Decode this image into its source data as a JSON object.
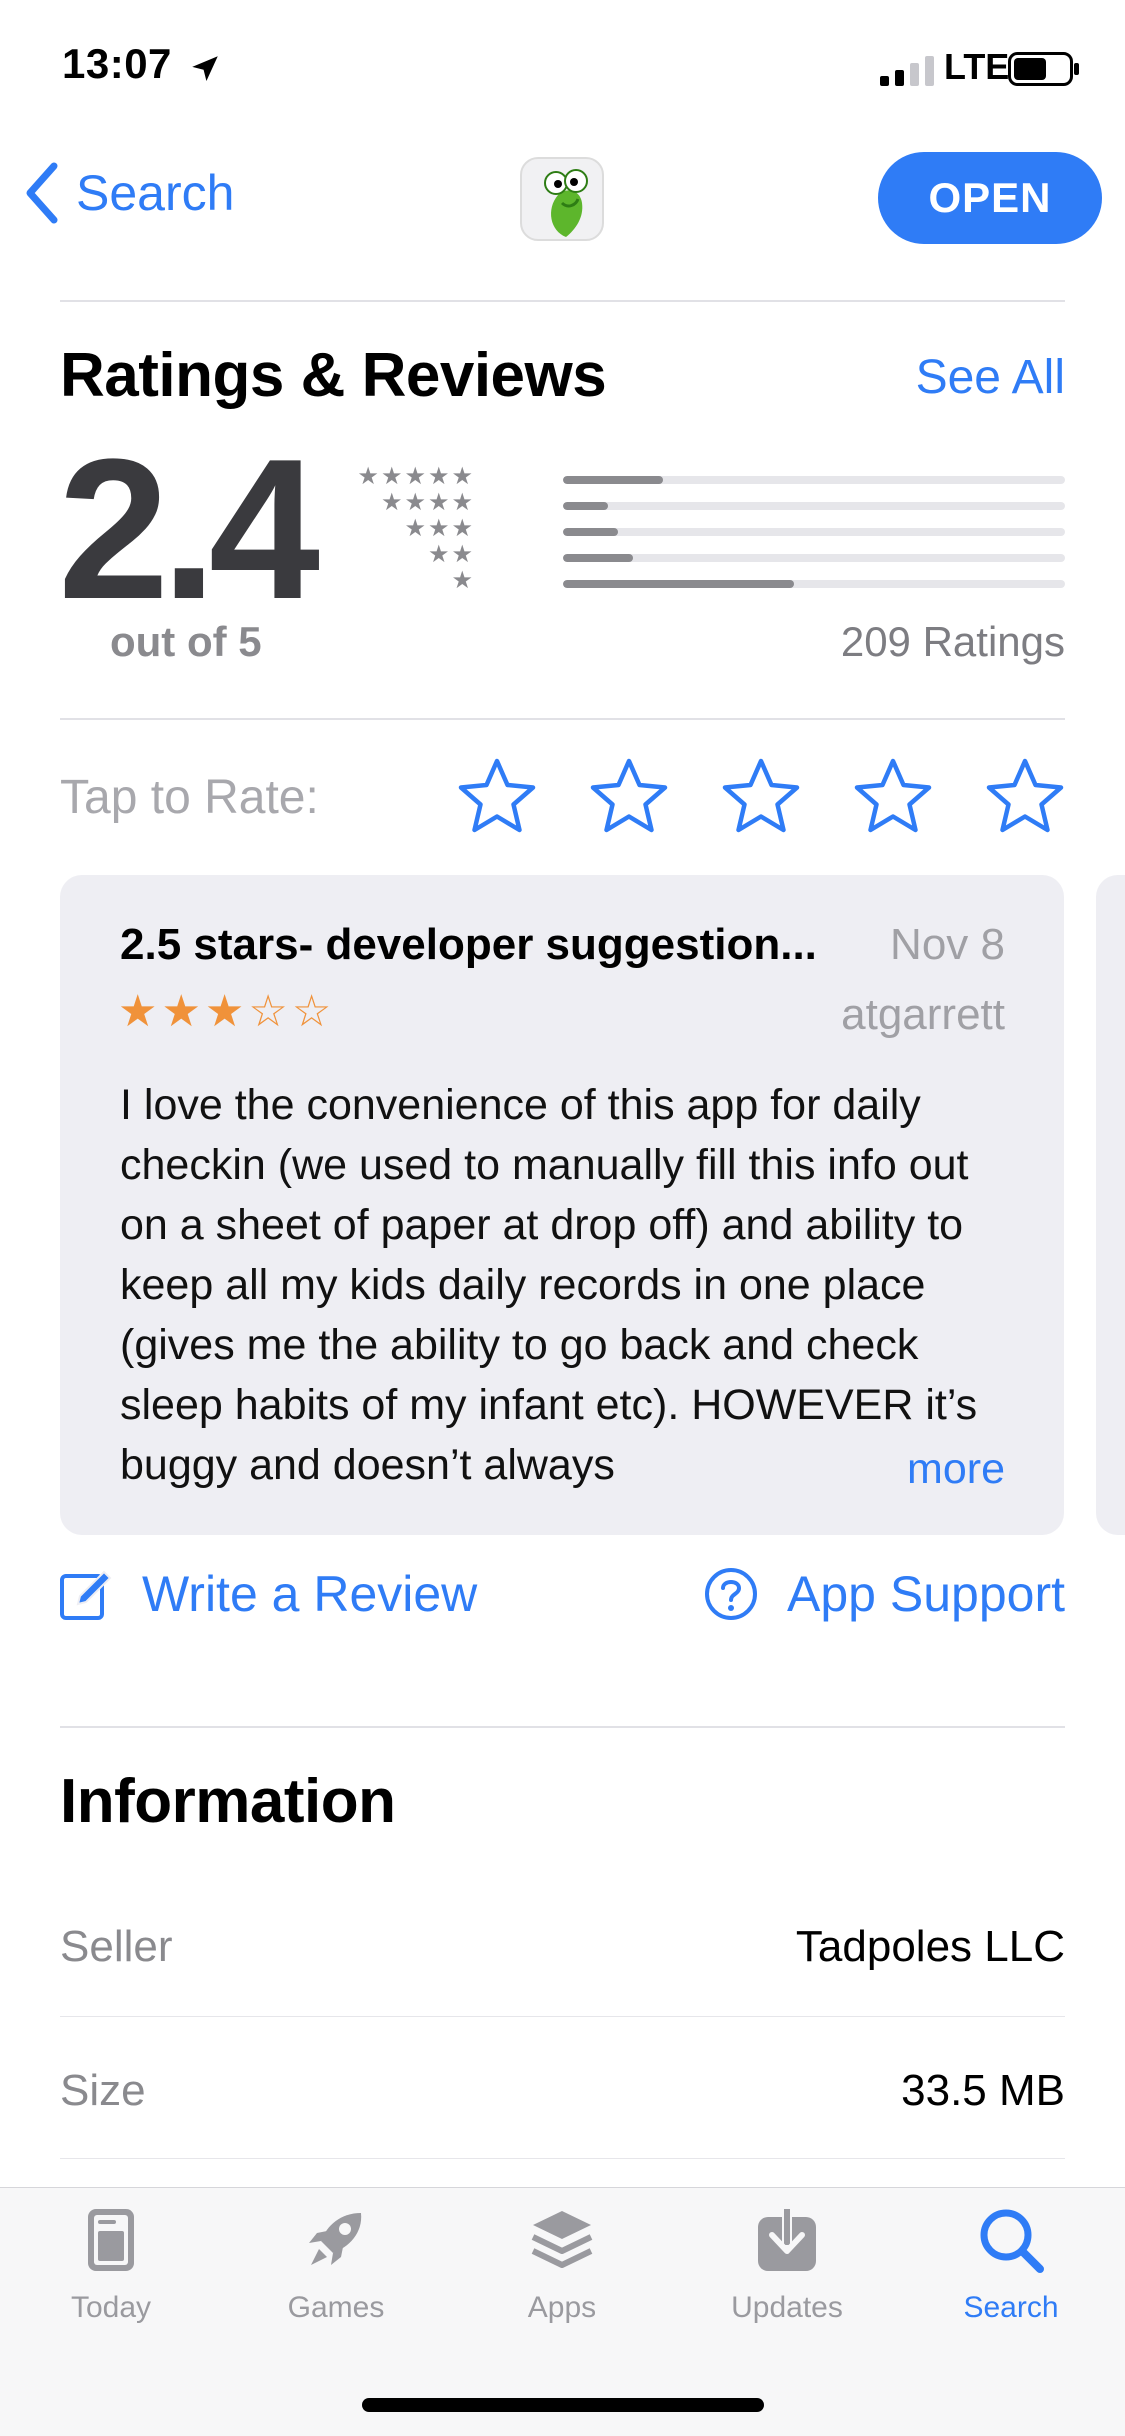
{
  "status_bar": {
    "time": "13:07",
    "network": "LTE"
  },
  "nav": {
    "back_label": "Search",
    "open_label": "OPEN"
  },
  "ratings": {
    "title": "Ratings & Reviews",
    "see_all": "See All",
    "average": "2.4",
    "out_of": "out of 5",
    "total": "209 Ratings",
    "distribution": [
      {
        "stars": 5,
        "fraction": 0.2
      },
      {
        "stars": 4,
        "fraction": 0.09
      },
      {
        "stars": 3,
        "fraction": 0.11
      },
      {
        "stars": 2,
        "fraction": 0.14
      },
      {
        "stars": 1,
        "fraction": 0.46
      }
    ]
  },
  "tap_to_rate": {
    "label": "Tap to Rate:",
    "stars": 5
  },
  "review": {
    "title": "2.5 stars- developer suggestion...",
    "date": "Nov 8",
    "author": "atgarrett",
    "rating": 3,
    "body": "I love the convenience of this app for daily checkin (we used to manually fill this info out on a sheet of paper at drop off) and ability to keep all my kids daily records in one place (gives me the ability to go back and check sleep habits of my infant etc). HOWEVER it’s buggy and doesn’t always",
    "more_label": "more"
  },
  "actions": {
    "write_review": "Write a Review",
    "app_support": "App Support"
  },
  "information": {
    "title": "Information",
    "rows": [
      {
        "label": "Seller",
        "value": "Tadpoles LLC"
      },
      {
        "label": "Size",
        "value": "33.5 MB"
      }
    ]
  },
  "tabbar": {
    "tabs": [
      {
        "label": "Today",
        "icon": "today-icon"
      },
      {
        "label": "Games",
        "icon": "rocket-icon"
      },
      {
        "label": "Apps",
        "icon": "layers-icon"
      },
      {
        "label": "Updates",
        "icon": "download-icon"
      },
      {
        "label": "Search",
        "icon": "search-icon",
        "active": true
      }
    ]
  },
  "colors": {
    "accent": "#2f7cf6",
    "review_star": "#f0923a",
    "card_bg": "#eeeef3"
  }
}
